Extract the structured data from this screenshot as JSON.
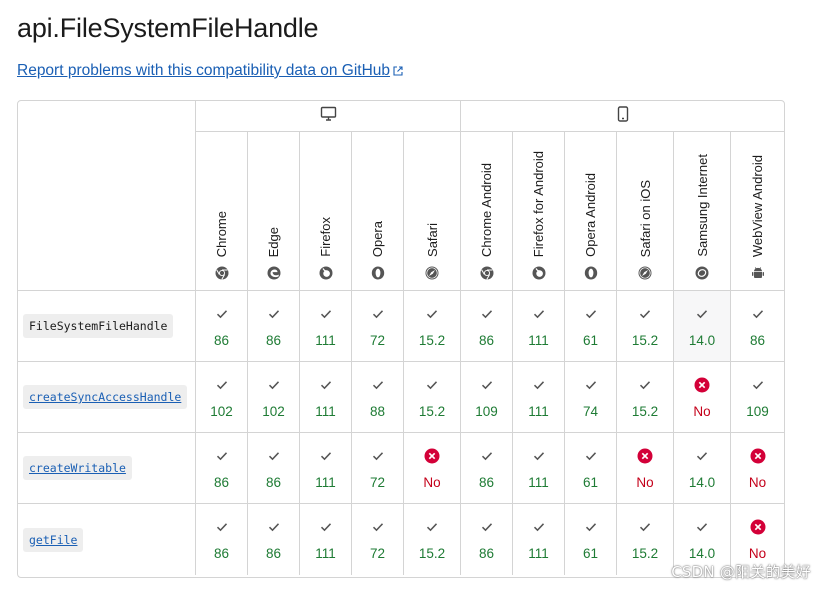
{
  "title": "api.FileSystemFileHandle",
  "report_link": "Report problems with this compatibility data on GitHub",
  "watermark": "CSDN @阳关的美好",
  "platforms": [
    {
      "name": "desktop-icon"
    },
    {
      "name": "mobile-icon"
    }
  ],
  "browsers": [
    {
      "label": "Chrome",
      "icon": "chrome-icon"
    },
    {
      "label": "Edge",
      "icon": "edge-icon"
    },
    {
      "label": "Firefox",
      "icon": "firefox-icon"
    },
    {
      "label": "Opera",
      "icon": "opera-icon"
    },
    {
      "label": "Safari",
      "icon": "safari-icon"
    },
    {
      "label": "Chrome Android",
      "icon": "chrome-icon"
    },
    {
      "label": "Firefox for Android",
      "icon": "firefox-icon"
    },
    {
      "label": "Opera Android",
      "icon": "opera-icon"
    },
    {
      "label": "Safari on iOS",
      "icon": "safari-icon"
    },
    {
      "label": "Samsung Internet",
      "icon": "samsung-icon"
    },
    {
      "label": "WebView Android",
      "icon": "android-icon"
    }
  ],
  "rows": [
    {
      "feature": "FileSystemFileHandle",
      "link": false,
      "cells": [
        {
          "s": "yes",
          "v": "86"
        },
        {
          "s": "yes",
          "v": "86"
        },
        {
          "s": "yes",
          "v": "111"
        },
        {
          "s": "yes",
          "v": "72"
        },
        {
          "s": "yes",
          "v": "15.2"
        },
        {
          "s": "yes",
          "v": "86"
        },
        {
          "s": "yes",
          "v": "111"
        },
        {
          "s": "yes",
          "v": "61"
        },
        {
          "s": "yes",
          "v": "15.2"
        },
        {
          "s": "yes",
          "v": "14.0"
        },
        {
          "s": "yes",
          "v": "86"
        }
      ]
    },
    {
      "feature": "createSyncAccessHandle",
      "link": true,
      "cells": [
        {
          "s": "yes",
          "v": "102"
        },
        {
          "s": "yes",
          "v": "102"
        },
        {
          "s": "yes",
          "v": "111"
        },
        {
          "s": "yes",
          "v": "88"
        },
        {
          "s": "yes",
          "v": "15.2"
        },
        {
          "s": "yes",
          "v": "109"
        },
        {
          "s": "yes",
          "v": "111"
        },
        {
          "s": "yes",
          "v": "74"
        },
        {
          "s": "yes",
          "v": "15.2"
        },
        {
          "s": "no",
          "v": "No"
        },
        {
          "s": "yes",
          "v": "109"
        }
      ]
    },
    {
      "feature": "createWritable",
      "link": true,
      "cells": [
        {
          "s": "yes",
          "v": "86"
        },
        {
          "s": "yes",
          "v": "86"
        },
        {
          "s": "yes",
          "v": "111"
        },
        {
          "s": "yes",
          "v": "72"
        },
        {
          "s": "no",
          "v": "No"
        },
        {
          "s": "yes",
          "v": "86"
        },
        {
          "s": "yes",
          "v": "111"
        },
        {
          "s": "yes",
          "v": "61"
        },
        {
          "s": "no",
          "v": "No"
        },
        {
          "s": "yes",
          "v": "14.0"
        },
        {
          "s": "no",
          "v": "No"
        }
      ]
    },
    {
      "feature": "getFile",
      "link": true,
      "cells": [
        {
          "s": "yes",
          "v": "86"
        },
        {
          "s": "yes",
          "v": "86"
        },
        {
          "s": "yes",
          "v": "111"
        },
        {
          "s": "yes",
          "v": "72"
        },
        {
          "s": "yes",
          "v": "15.2"
        },
        {
          "s": "yes",
          "v": "86"
        },
        {
          "s": "yes",
          "v": "111"
        },
        {
          "s": "yes",
          "v": "61"
        },
        {
          "s": "yes",
          "v": "15.2"
        },
        {
          "s": "yes",
          "v": "14.0"
        },
        {
          "s": "no",
          "v": "No"
        }
      ]
    }
  ],
  "colors": {
    "yes": "#1e7b34",
    "no": "#d30038",
    "link": "#1a5fb4",
    "border": "#d4d4d4"
  }
}
